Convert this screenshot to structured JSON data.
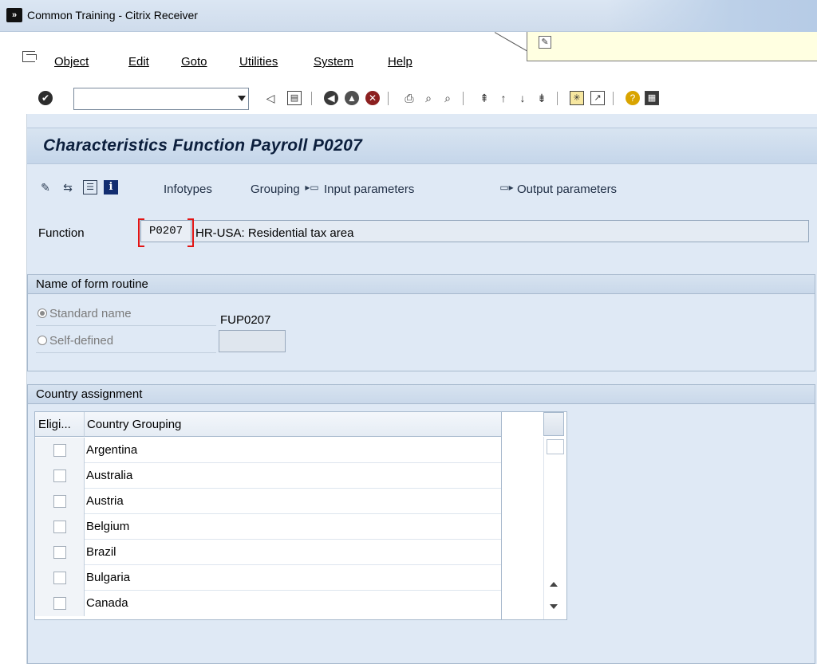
{
  "window": {
    "title": "Common Training - Citrix Receiver",
    "app_icon_glyph": "»"
  },
  "menu": {
    "items": [
      "Object",
      "Edit",
      "Goto",
      "Utilities",
      "System",
      "Help"
    ]
  },
  "toolbar": {
    "command_field_value": ""
  },
  "page": {
    "title": "Characteristics Function Payroll P0207"
  },
  "app_toolbar": {
    "infotypes": "Infotypes",
    "grouping": "Grouping",
    "input_params": "Input parameters",
    "output_params": "Output parameters"
  },
  "function": {
    "label": "Function",
    "code": "P0207",
    "description": "HR-USA: Residential tax area"
  },
  "form_routine": {
    "heading": "Name of form routine",
    "standard_label": "Standard name",
    "standard_value": "FUP0207",
    "self_label": "Self-defined",
    "self_value": ""
  },
  "country": {
    "heading": "Country assignment",
    "columns": [
      "Eligi...",
      "Country Grouping"
    ],
    "rows": [
      "Argentina",
      "Australia",
      "Austria",
      "Belgium",
      "Brazil",
      "Bulgaria",
      "Canada"
    ]
  },
  "colors": {
    "title_blue": "#0c1f3d",
    "highlight_red": "#e21414",
    "panel": "#dfe9f5"
  }
}
